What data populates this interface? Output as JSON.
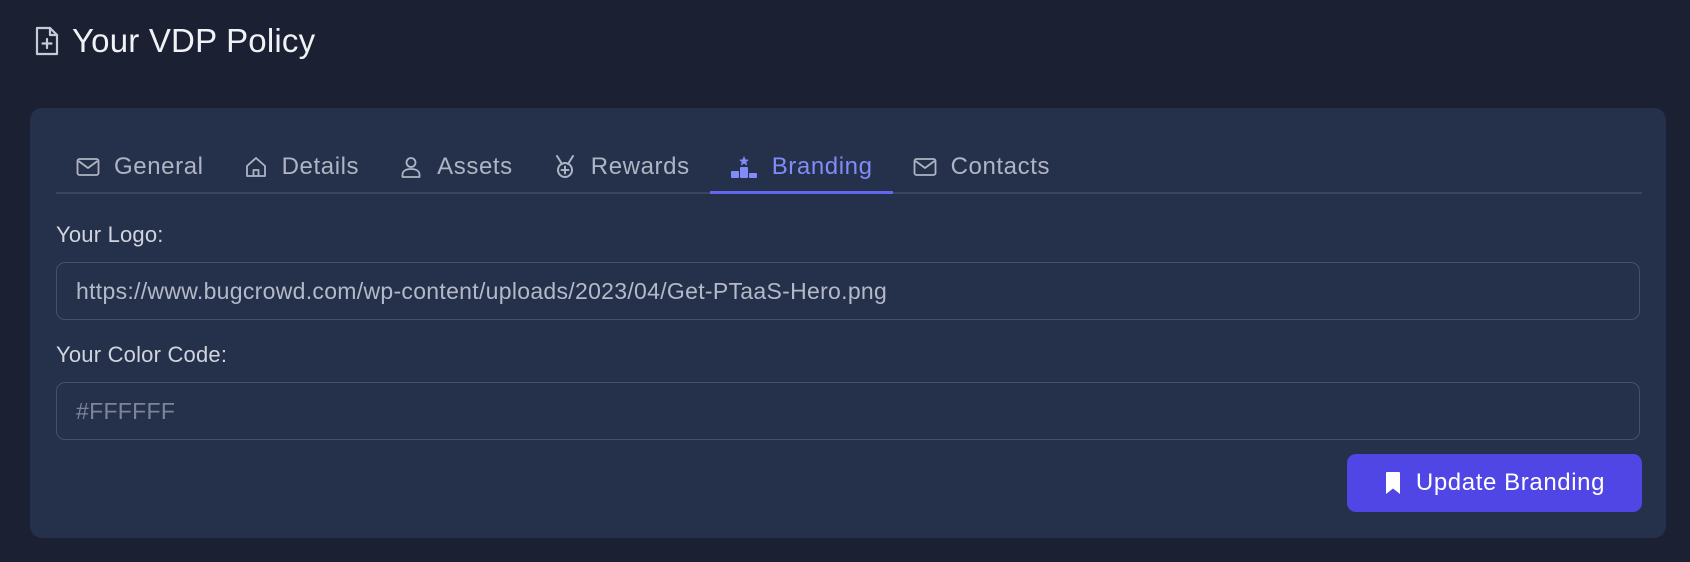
{
  "header": {
    "title": "Your VDP Policy",
    "icon": "file-plus-icon"
  },
  "tabs": [
    {
      "label": "General",
      "icon": "mail-icon",
      "active": false
    },
    {
      "label": "Details",
      "icon": "home-icon",
      "active": false
    },
    {
      "label": "Assets",
      "icon": "user-icon",
      "active": false
    },
    {
      "label": "Rewards",
      "icon": "medal-icon",
      "active": false
    },
    {
      "label": "Branding",
      "icon": "podium-icon",
      "active": true
    },
    {
      "label": "Contacts",
      "icon": "mail-icon",
      "active": false
    }
  ],
  "form": {
    "logo_label": "Your Logo:",
    "logo_value": "https://www.bugcrowd.com/wp-content/uploads/2023/04/Get-PTaaS-Hero.png",
    "color_label": "Your Color Code:",
    "color_placeholder": "#FFFFFF",
    "color_value": "",
    "submit_label": "Update Branding",
    "submit_icon": "bookmark-icon"
  },
  "colors": {
    "background": "#1b2032",
    "card": "#25314b",
    "accent": "#4f46e5",
    "active_tab": "#818cf8"
  }
}
